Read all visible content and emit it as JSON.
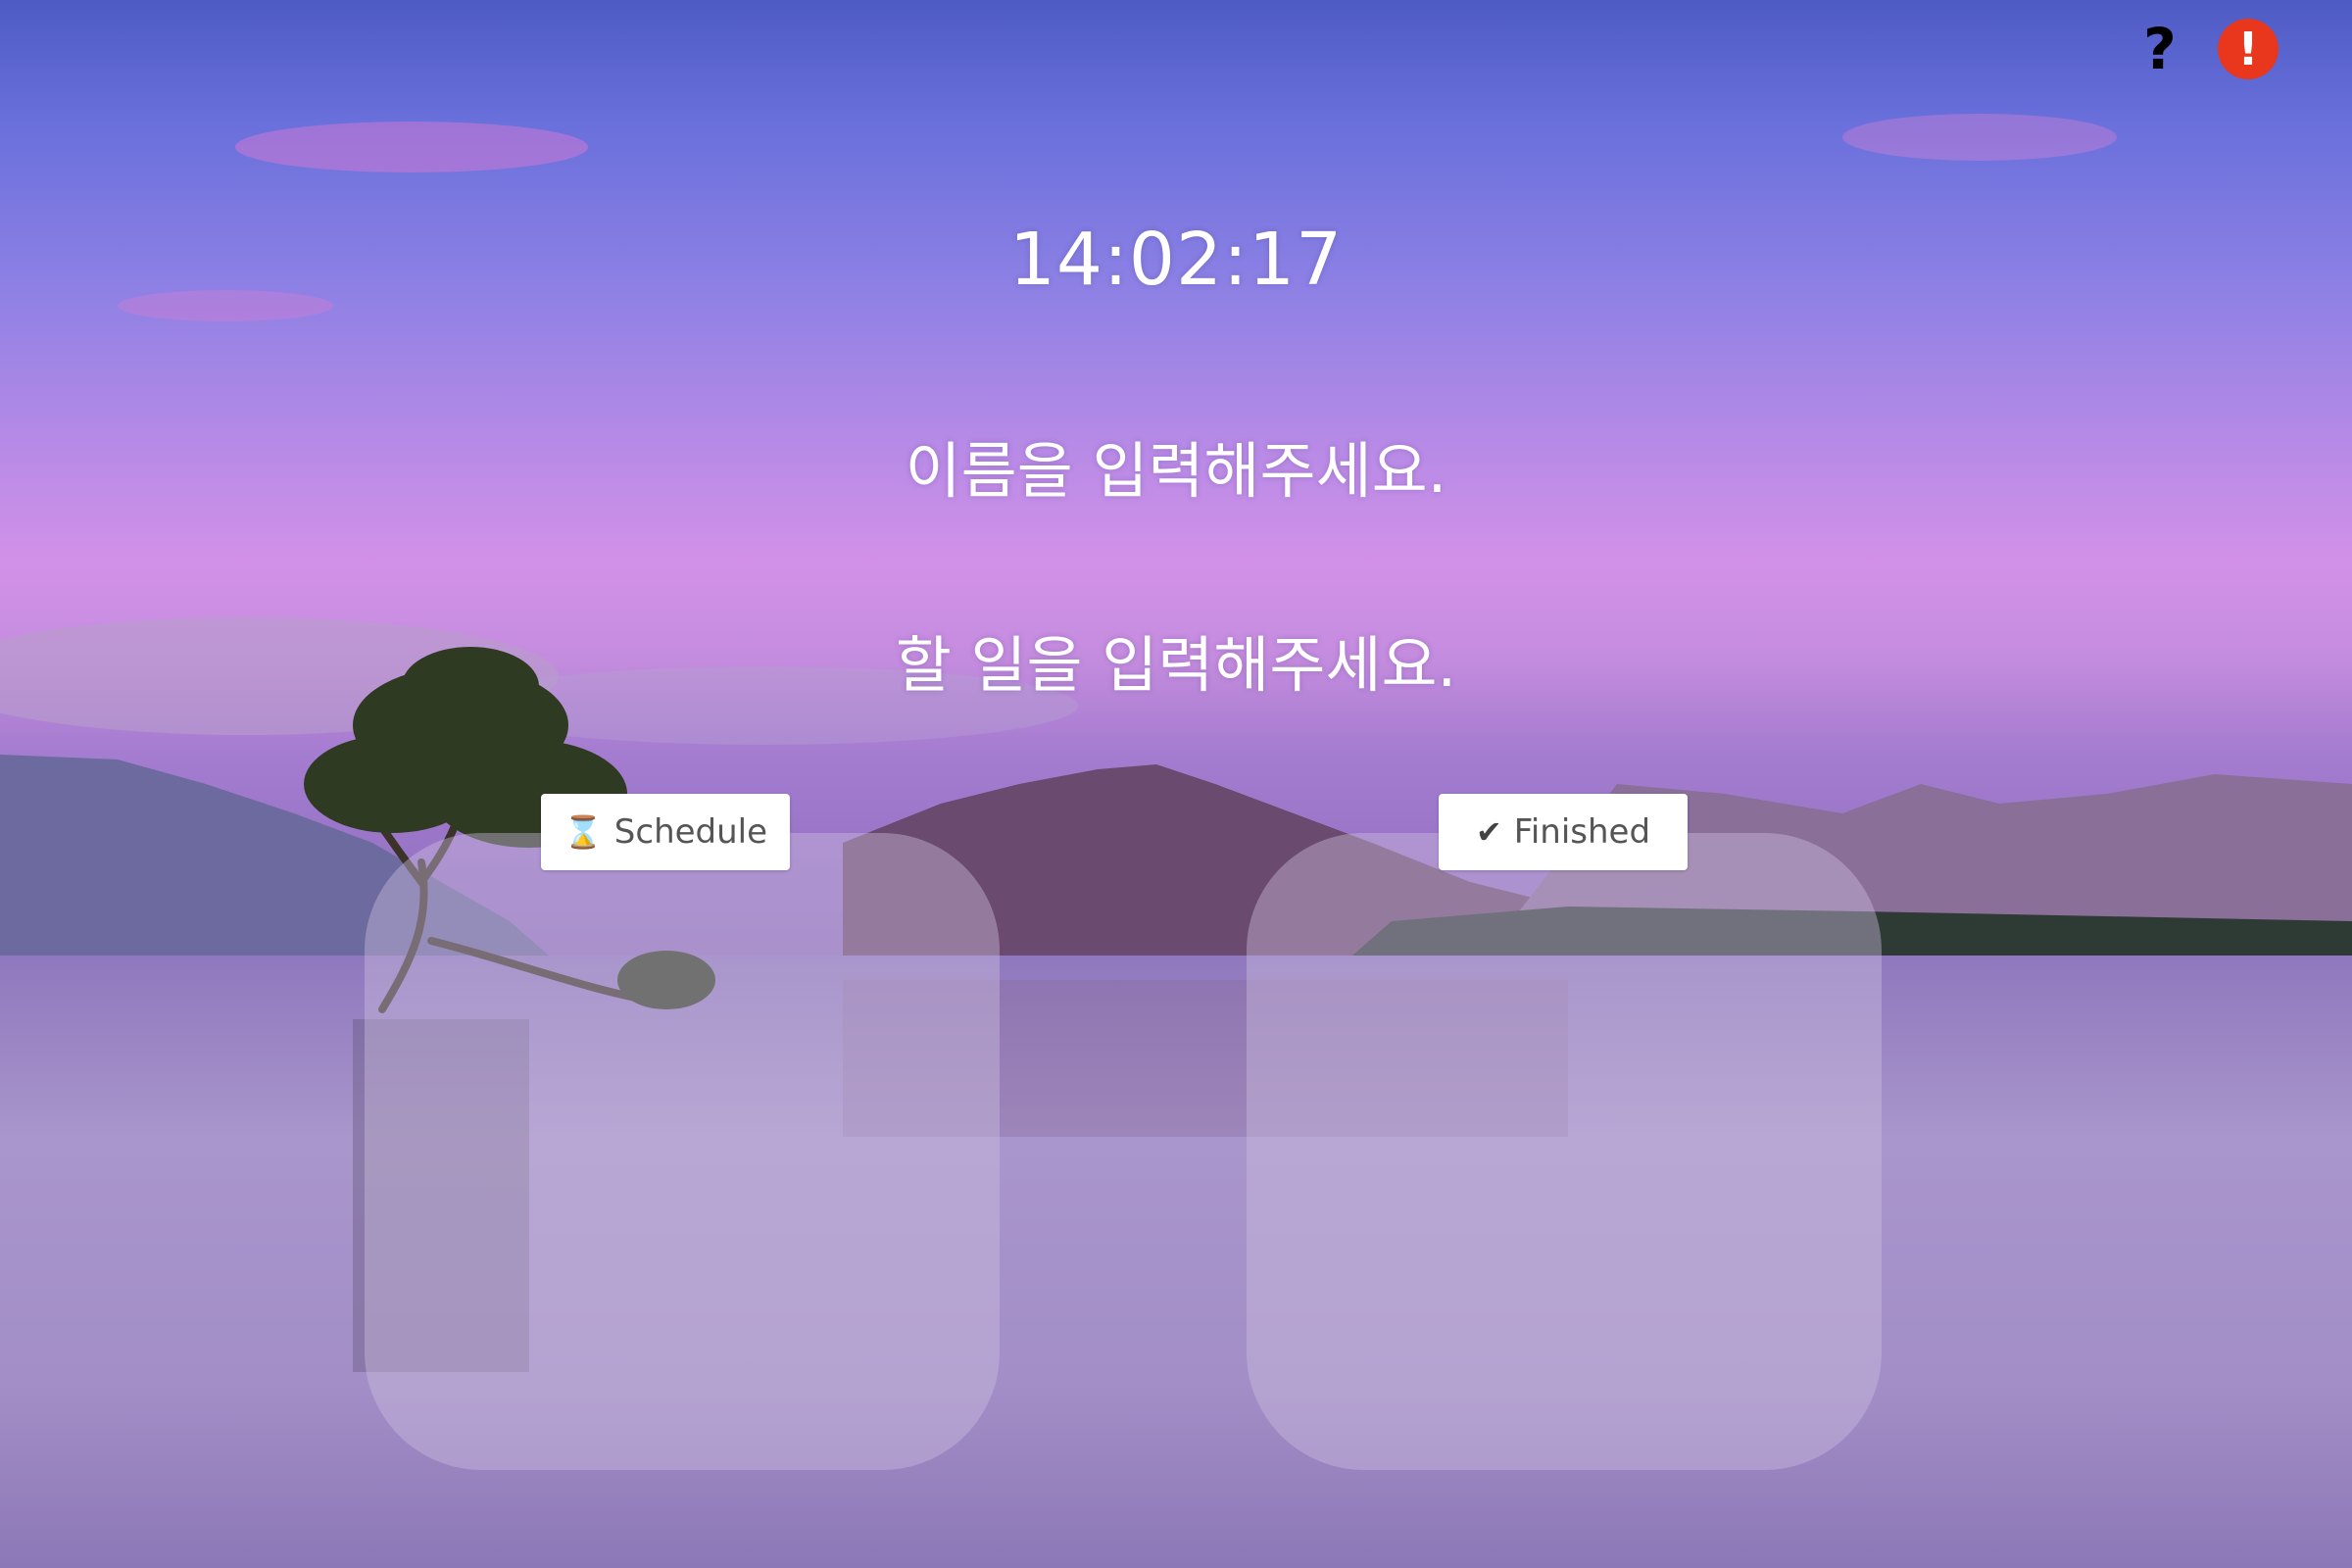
{
  "topbar": {
    "help_icon": "question-mark-icon",
    "help_glyph": "?",
    "alert_icon": "alert-circle-icon",
    "alert_glyph": "!"
  },
  "clock": {
    "time": "14:02:17"
  },
  "prompts": {
    "name": "이름을 입력해주세요.",
    "todo": "할 일을 입력해주세요."
  },
  "schedule": {
    "icon": "hourglass-icon",
    "icon_glyph": "⌛",
    "label": "Schedule"
  },
  "finished": {
    "icon": "check-icon",
    "icon_glyph": "✔",
    "label": "Finished"
  },
  "colors": {
    "alert": "#e8371c",
    "button_bg": "#ffffff",
    "text": "#ffffff"
  }
}
